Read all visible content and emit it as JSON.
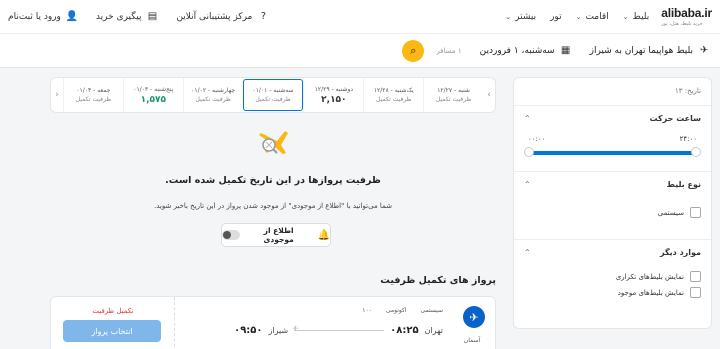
{
  "header": {
    "brand": "alibaba.ir",
    "tagline": "خرید بلیط، هتل، تور",
    "nav": [
      "بلیط",
      "اقامت",
      "تور",
      "بیشتر"
    ],
    "support": "مرکز پشتیبانی آنلاین",
    "track": "پیگیری خرید",
    "login": "ورود یا ثبت‌نام"
  },
  "search": {
    "route": "بلیط هواپیما تهران به شیراز",
    "date": "سه‌شنبه، ۱ فروردین",
    "passengers": "۱ مسافر"
  },
  "sidebar": {
    "date_label": "تاریخ: ۱۳",
    "time_title": "ساعت حرکت",
    "time_from": "۰۰:۰۰",
    "time_to": "۲۴:۰۰",
    "time_range": [
      0,
      24
    ],
    "ticket_type_title": "نوع بلیط",
    "ticket_type_option": "سیستمی",
    "other_title": "موارد دیگر",
    "other_options": [
      "نمایش بلیط‌های تکراری",
      "نمایش بلیط‌های موجود"
    ]
  },
  "date_strip": [
    {
      "day": "شنبه - ۱۲/۲۷",
      "price": "",
      "note": "ظرفیت تکمیل"
    },
    {
      "day": "یک‌شنبه - ۱۲/۲۸",
      "price": "",
      "note": "ظرفیت تکمیل"
    },
    {
      "day": "دوشنبه - ۱۲/۲۹",
      "price": "۲,۱۵۰",
      "note": ""
    },
    {
      "day": "سه‌شنبه - ۰۱/۰۱",
      "price": "",
      "note": "ظرفیت تکمیل",
      "active": true
    },
    {
      "day": "چهارشنبه - ۰۱/۰۲",
      "price": "",
      "note": "ظرفیت تکمیل"
    },
    {
      "day": "پنج‌شنبه - ۰۱/۰۳",
      "price": "۱,۵۷۵",
      "note": "",
      "green": true
    },
    {
      "day": "جمعه - ۰۱/۰۴",
      "price": "",
      "note": "ظرفیت تکمیل"
    }
  ],
  "empty_state": {
    "title": "ظرفیت پروازها در این تاریخ تکمیل شده است.",
    "subtitle": "شما می‌توانید با \"اطلاع از موجودی\" از موجود شدن پرواز در این تاریخ باخبر شوید.",
    "notify_label": "اطلاع از موجودی"
  },
  "full_section_title": "پرواز های تکمیل ظرفیت",
  "flight": {
    "status": "تکمیل ظرفیت",
    "select_label": "انتخاب پرواز",
    "airline": "آسمان",
    "tags": [
      "سیستمی",
      "اکونومی",
      "۱۰۰"
    ],
    "from_city": "تهران",
    "from_time": "۰۸:۲۵",
    "to_city": "شیراز",
    "to_time": "۰۹:۵۰"
  }
}
